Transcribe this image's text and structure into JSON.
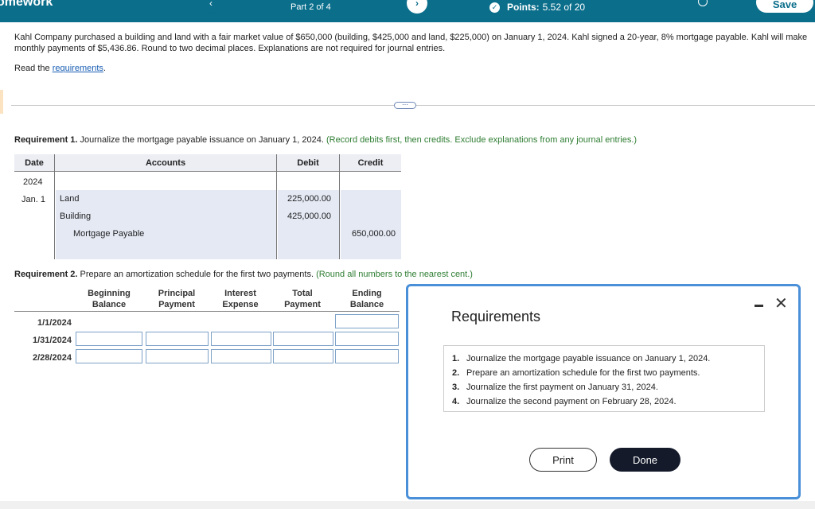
{
  "topbar": {
    "app_title": "omework",
    "part": "Part 2 of 4",
    "prev_symbol": "‹",
    "next_symbol": "›",
    "points_label": "Points:",
    "points_value": "5.52 of 20",
    "save_label": "Save"
  },
  "problem": {
    "text": "Kahl Company purchased a building and land with a fair market value of $650,000 (building, $425,000 and land, $225,000) on January 1, 2024. Kahl signed a 20-year, 8% mortgage payable. Kahl will make monthly payments of $5,436.86. Round to two decimal places. Explanations are not required for journal entries.",
    "read_prefix": "Read the ",
    "read_link": "requirements",
    "read_suffix": "."
  },
  "divider_handle": "⋯",
  "req1": {
    "label": "Requirement 1.",
    "text": " Journalize the mortgage payable issuance on January 1, 2024.",
    "hint": " (Record debits first, then credits. Exclude explanations from any journal entries.)"
  },
  "journal": {
    "headers": {
      "date": "Date",
      "accounts": "Accounts",
      "debit": "Debit",
      "credit": "Credit"
    },
    "year": "2024",
    "date": "Jan. 1",
    "rows": [
      {
        "account": "Land",
        "debit": "225,000.00",
        "credit": ""
      },
      {
        "account": "Building",
        "debit": "425,000.00",
        "credit": ""
      },
      {
        "account": "Mortgage Payable",
        "debit": "",
        "credit": "650,000.00"
      }
    ]
  },
  "req2": {
    "label": "Requirement 2.",
    "text": " Prepare an amortization schedule for the first two payments.",
    "hint": " (Round all numbers to the nearest cent.)"
  },
  "amortization": {
    "headers": [
      [
        "Beginning",
        "Balance"
      ],
      [
        "Principal",
        "Payment"
      ],
      [
        "Interest",
        "Expense"
      ],
      [
        "Total",
        "Payment"
      ],
      [
        "Ending",
        "Balance"
      ]
    ],
    "rows": [
      "1/1/2024",
      "1/31/2024",
      "2/28/2024"
    ]
  },
  "modal": {
    "title": "Requirements",
    "items": [
      {
        "num": "1.",
        "text": "Journalize the mortgage payable issuance on January 1, 2024."
      },
      {
        "num": "2.",
        "text": "Prepare an amortization schedule for the first two payments."
      },
      {
        "num": "3.",
        "text": "Journalize the first payment on January 31, 2024."
      },
      {
        "num": "4.",
        "text": "Journalize the second payment on February 28, 2024."
      }
    ],
    "print_label": "Print",
    "done_label": "Done",
    "close_symbol": "✕"
  },
  "colors": {
    "topbar": "#0b6e8b",
    "hint_green": "#2e7d32",
    "link_blue": "#1a5fb4",
    "modal_border": "#4a90d9"
  }
}
